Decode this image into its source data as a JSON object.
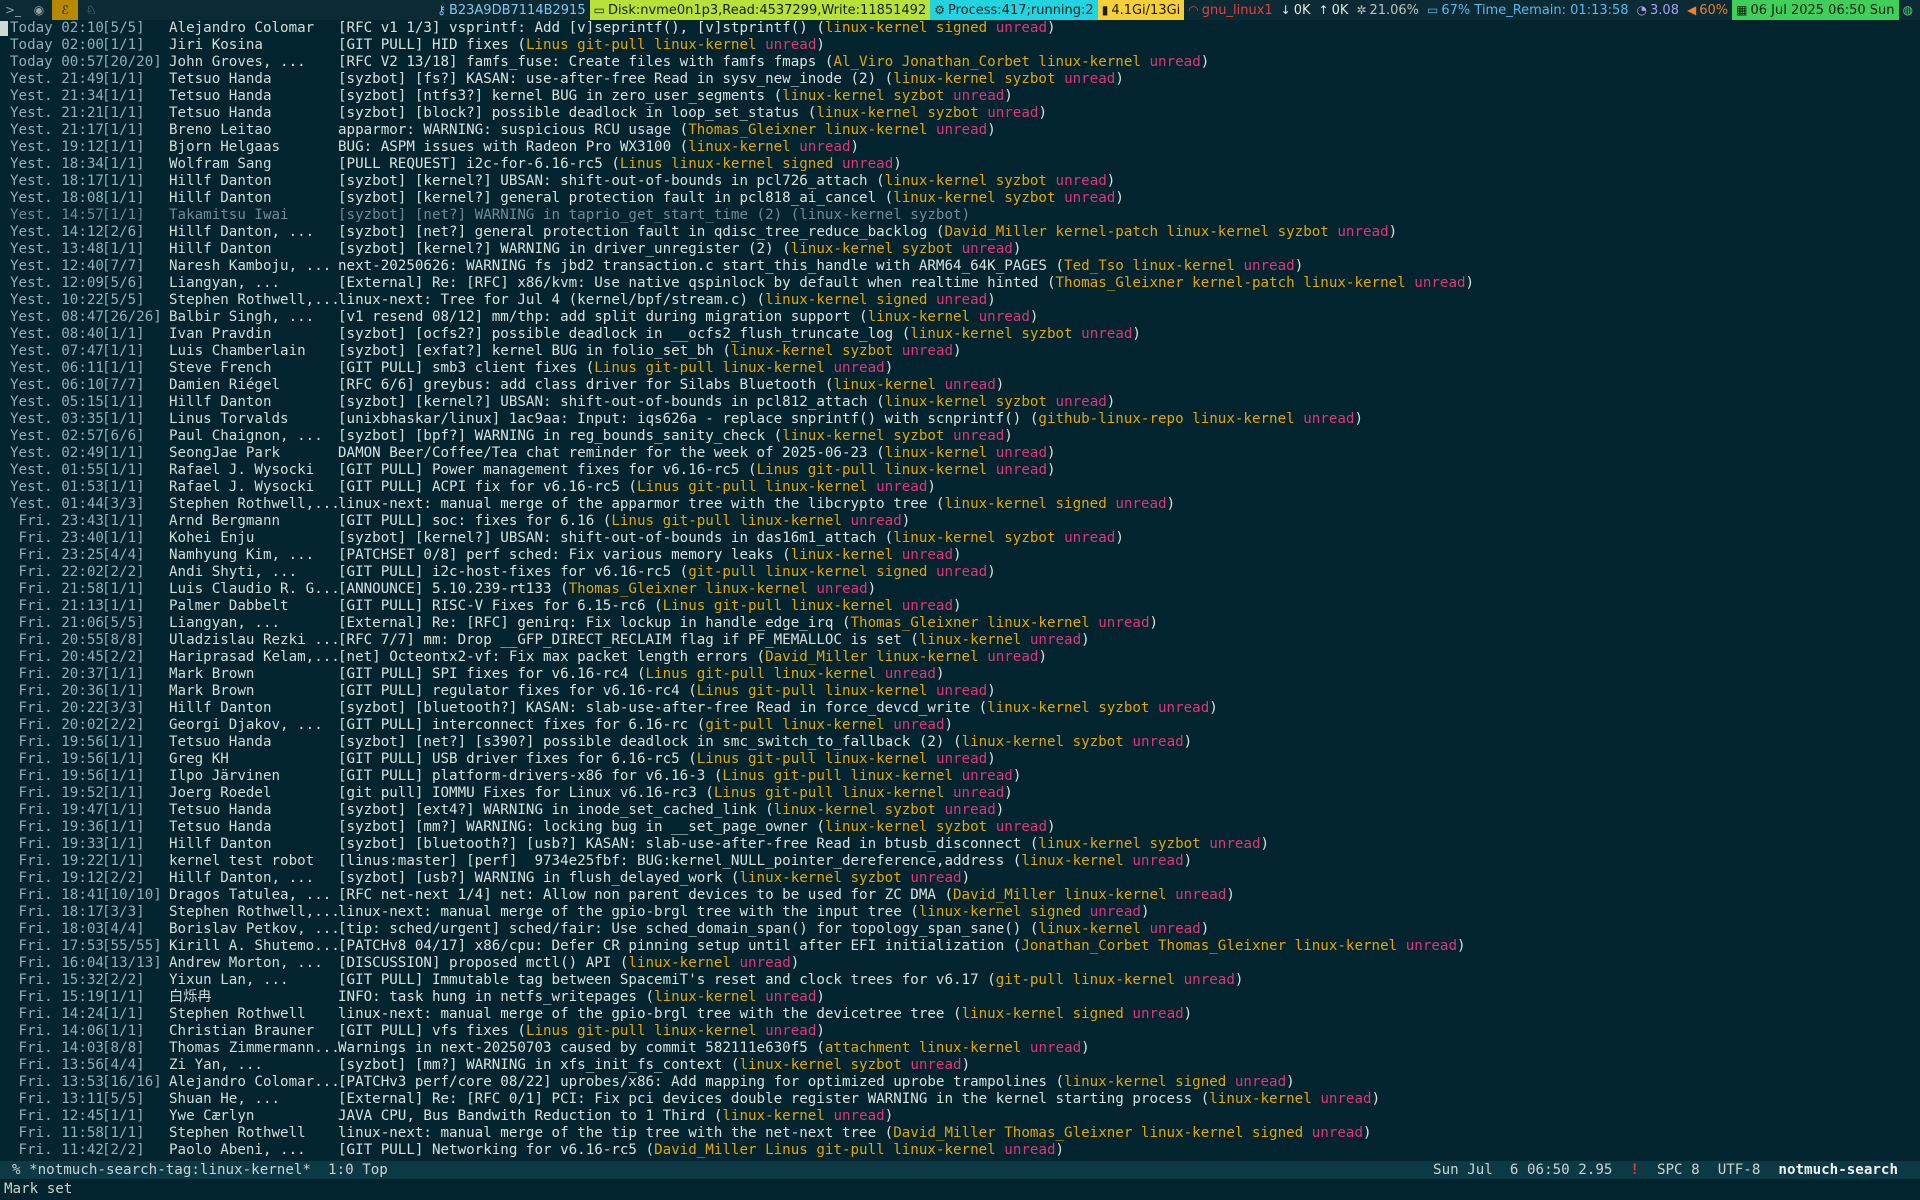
{
  "topbar": {
    "workspaces": [
      {
        "icon": "terminal-icon",
        "glyph": ">_",
        "active": false
      },
      {
        "icon": "firefox-icon",
        "glyph": "◉",
        "active": false
      },
      {
        "icon": "emacs-icon",
        "glyph": "ℰ",
        "active": true
      },
      {
        "icon": "bird-icon",
        "glyph": "♘",
        "active": false
      }
    ],
    "segments": [
      {
        "name": "key-segment",
        "icon": "key-icon",
        "glyph": "⚷",
        "text": "B23A9DB7114B2915",
        "bg": "#0a2a34",
        "fg": "#7fc8f0"
      },
      {
        "name": "disk-segment",
        "icon": "disk-icon",
        "glyph": "▭",
        "text": "Disk:nvme0n1p3,Read:4537299,Write:11851492",
        "bg": "#b8e23a",
        "fg": "#102010"
      },
      {
        "name": "process-segment",
        "icon": "process-icon",
        "glyph": "⚙",
        "text": "Process:417;running:2",
        "bg": "#22d3e0",
        "fg": "#102020"
      },
      {
        "name": "memory-segment",
        "icon": "memory-icon",
        "glyph": "▮",
        "text": "4.1Gi/13Gi",
        "bg": "#f5d03a",
        "fg": "#201800"
      },
      {
        "name": "wifi-segment",
        "icon": "wifi-icon",
        "glyph": "◠",
        "text": "gnu_linux1",
        "bg": "#0a2a34",
        "fg": "#e84040"
      },
      {
        "name": "download-segment",
        "icon": "download-icon",
        "glyph": "↓",
        "text": "0K",
        "bg": "#0a2a34",
        "fg": "#e0e8e8"
      },
      {
        "name": "upload-segment",
        "icon": "upload-icon",
        "glyph": "↑",
        "text": "0K",
        "bg": "#0a2a34",
        "fg": "#e0e8e8"
      },
      {
        "name": "cpu-segment",
        "icon": "cpu-icon",
        "glyph": "✲",
        "text": "21.06%",
        "bg": "#0a2a34",
        "fg": "#b8c4c4"
      },
      {
        "name": "battery-segment",
        "icon": "battery-icon",
        "glyph": "▭",
        "text": "67% Time_Remain: 01:13:58",
        "bg": "#0a2a34",
        "fg": "#59b8f0"
      },
      {
        "name": "load-segment",
        "icon": "gauge-icon",
        "glyph": "◔",
        "text": "3.08",
        "bg": "#0a2a34",
        "fg": "#a6a0f0"
      },
      {
        "name": "volume-segment",
        "icon": "speaker-icon",
        "glyph": "◀",
        "text": "60%",
        "bg": "#0a2a34",
        "fg": "#f07f2a"
      },
      {
        "name": "clock-segment",
        "icon": "calendar-icon",
        "glyph": "▦",
        "text": "06 Jul 2025 06:50 Sun",
        "bg": "#3fcf5a",
        "fg": "#0a200a"
      },
      {
        "name": "tray-segment",
        "icon": "tray-icon",
        "glyph": "◍",
        "text": "",
        "bg": "#0a2a34",
        "fg": "#4fd07a"
      }
    ]
  },
  "threads": [
    [
      "Today 02:10",
      "[5/5]",
      "Alejandro Colomar",
      "[RFC v1 1/3] vsprintf: Add [v]seprintf(), [v]stprintf()",
      "linux-kernel signed",
      true
    ],
    [
      "Today 02:00",
      "[1/1]",
      "Jiri Kosina",
      "[GIT PULL] HID fixes",
      "Linus git-pull linux-kernel",
      true
    ],
    [
      "Today 00:57",
      "[20/20]",
      "John Groves, ...",
      "[RFC V2 13/18] famfs_fuse: Create files with famfs fmaps",
      "Al_Viro Jonathan_Corbet linux-kernel",
      true
    ],
    [
      "Yest. 21:49",
      "[1/1]",
      "Tetsuo Handa",
      "[syzbot] [fs?] KASAN: use-after-free Read in sysv_new_inode (2)",
      "linux-kernel syzbot",
      true
    ],
    [
      "Yest. 21:34",
      "[1/1]",
      "Tetsuo Handa",
      "[syzbot] [ntfs3?] kernel BUG in zero_user_segments",
      "linux-kernel syzbot",
      true
    ],
    [
      "Yest. 21:21",
      "[1/1]",
      "Tetsuo Handa",
      "[syzbot] [block?] possible deadlock in loop_set_status",
      "linux-kernel syzbot",
      true
    ],
    [
      "Yest. 21:17",
      "[1/1]",
      "Breno Leitao",
      "apparmor: WARNING: suspicious RCU usage",
      "Thomas_Gleixner linux-kernel",
      true
    ],
    [
      "Yest. 19:12",
      "[1/1]",
      "Bjorn Helgaas",
      "BUG: ASPM issues with Radeon Pro WX3100",
      "linux-kernel",
      true
    ],
    [
      "Yest. 18:34",
      "[1/1]",
      "Wolfram Sang",
      "[PULL REQUEST] i2c-for-6.16-rc5",
      "Linus linux-kernel signed",
      true
    ],
    [
      "Yest. 18:17",
      "[1/1]",
      "Hillf Danton",
      "[syzbot] [kernel?] UBSAN: shift-out-of-bounds in pcl726_attach",
      "linux-kernel syzbot",
      true
    ],
    [
      "Yest. 18:08",
      "[1/1]",
      "Hillf Danton",
      "[syzbot] [kernel?] general protection fault in pcl818_ai_cancel",
      "linux-kernel syzbot",
      true
    ],
    [
      "Yest. 14:57",
      "[1/1]",
      "Takamitsu Iwai",
      "[syzbot] [net?] WARNING in taprio_get_start_time (2)",
      "linux-kernel syzbot",
      false
    ],
    [
      "Yest. 14:12",
      "[2/6]",
      "Hillf Danton, ...",
      "[syzbot] [net?] general protection fault in qdisc_tree_reduce_backlog",
      "David_Miller kernel-patch linux-kernel syzbot",
      true
    ],
    [
      "Yest. 13:48",
      "[1/1]",
      "Hillf Danton",
      "[syzbot] [kernel?] WARNING in driver_unregister (2)",
      "linux-kernel syzbot",
      true
    ],
    [
      "Yest. 12:40",
      "[7/7]",
      "Naresh Kamboju, ...",
      "next-20250626: WARNING fs jbd2 transaction.c start_this_handle with ARM64_64K_PAGES",
      "Ted_Tso linux-kernel",
      true
    ],
    [
      "Yest. 12:09",
      "[5/6]",
      "Liangyan, ...",
      "[External] Re: [RFC] x86/kvm: Use native qspinlock by default when realtime hinted",
      "Thomas_Gleixner kernel-patch linux-kernel",
      true
    ],
    [
      "Yest. 10:22",
      "[5/5]",
      "Stephen Rothwell,...",
      "linux-next: Tree for Jul 4 (kernel/bpf/stream.c)",
      "linux-kernel signed",
      true
    ],
    [
      "Yest. 08:47",
      "[26/26]",
      "Balbir Singh, ...",
      "[v1 resend 08/12] mm/thp: add split during migration support",
      "linux-kernel",
      true
    ],
    [
      "Yest. 08:40",
      "[1/1]",
      "Ivan Pravdin",
      "[syzbot] [ocfs2?] possible deadlock in __ocfs2_flush_truncate_log",
      "linux-kernel syzbot",
      true
    ],
    [
      "Yest. 07:47",
      "[1/1]",
      "Luis Chamberlain",
      "[syzbot] [exfat?] kernel BUG in folio_set_bh",
      "linux-kernel syzbot",
      true
    ],
    [
      "Yest. 06:11",
      "[1/1]",
      "Steve French",
      "[GIT PULL] smb3 client fixes",
      "Linus git-pull linux-kernel",
      true
    ],
    [
      "Yest. 06:10",
      "[7/7]",
      "Damien Riégel",
      "[RFC 6/6] greybus: add class driver for Silabs Bluetooth",
      "linux-kernel",
      true
    ],
    [
      "Yest. 05:15",
      "[1/1]",
      "Hillf Danton",
      "[syzbot] [kernel?] UBSAN: shift-out-of-bounds in pcl812_attach",
      "linux-kernel syzbot",
      true
    ],
    [
      "Yest. 03:35",
      "[1/1]",
      "Linus Torvalds",
      "[unixbhaskar/linux] 1ac9aa: Input: iqs626a - replace snprintf() with scnprintf()",
      "github-linux-repo linux-kernel",
      true
    ],
    [
      "Yest. 02:57",
      "[6/6]",
      "Paul Chaignon, ...",
      "[syzbot] [bpf?] WARNING in reg_bounds_sanity_check",
      "linux-kernel syzbot",
      true
    ],
    [
      "Yest. 02:49",
      "[1/1]",
      "SeongJae Park",
      "DAMON Beer/Coffee/Tea chat reminder for the week of 2025-06-23",
      "linux-kernel",
      true
    ],
    [
      "Yest. 01:55",
      "[1/1]",
      "Rafael J. Wysocki",
      "[GIT PULL] Power management fixes for v6.16-rc5",
      "Linus git-pull linux-kernel",
      true
    ],
    [
      "Yest. 01:53",
      "[1/1]",
      "Rafael J. Wysocki",
      "[GIT PULL] ACPI fix for v6.16-rc5",
      "Linus git-pull linux-kernel",
      true
    ],
    [
      "Yest. 01:44",
      "[3/3]",
      "Stephen Rothwell,...",
      "linux-next: manual merge of the apparmor tree with the libcrypto tree",
      "linux-kernel signed",
      true
    ],
    [
      " Fri. 23:43",
      "[1/1]",
      "Arnd Bergmann",
      "[GIT PULL] soc: fixes for 6.16",
      "Linus git-pull linux-kernel",
      true
    ],
    [
      " Fri. 23:40",
      "[1/1]",
      "Kohei Enju",
      "[syzbot] [kernel?] UBSAN: shift-out-of-bounds in das16m1_attach",
      "linux-kernel syzbot",
      true
    ],
    [
      " Fri. 23:25",
      "[4/4]",
      "Namhyung Kim, ...",
      "[PATCHSET 0/8] perf sched: Fix various memory leaks",
      "linux-kernel",
      true
    ],
    [
      " Fri. 22:02",
      "[2/2]",
      "Andi Shyti, ...",
      "[GIT PULL] i2c-host-fixes for v6.16-rc5",
      "git-pull linux-kernel signed",
      true
    ],
    [
      " Fri. 21:58",
      "[1/1]",
      "Luis Claudio R. G...",
      "[ANNOUNCE] 5.10.239-rt133",
      "Thomas_Gleixner linux-kernel",
      true
    ],
    [
      " Fri. 21:13",
      "[1/1]",
      "Palmer Dabbelt",
      "[GIT PULL] RISC-V Fixes for 6.15-rc6",
      "Linus git-pull linux-kernel",
      true
    ],
    [
      " Fri. 21:06",
      "[5/5]",
      "Liangyan, ...",
      "[External] Re: [RFC] genirq: Fix lockup in handle_edge_irq",
      "Thomas_Gleixner linux-kernel",
      true
    ],
    [
      " Fri. 20:55",
      "[8/8]",
      "Uladzislau Rezki ...",
      "[RFC 7/7] mm: Drop __GFP_DIRECT_RECLAIM flag if PF_MEMALLOC is set",
      "linux-kernel",
      true
    ],
    [
      " Fri. 20:45",
      "[2/2]",
      "Hariprasad Kelam,...",
      "[net] Octeontx2-vf: Fix max packet length errors",
      "David_Miller linux-kernel",
      true
    ],
    [
      " Fri. 20:37",
      "[1/1]",
      "Mark Brown",
      "[GIT PULL] SPI fixes for v6.16-rc4",
      "Linus git-pull linux-kernel",
      true
    ],
    [
      " Fri. 20:36",
      "[1/1]",
      "Mark Brown",
      "[GIT PULL] regulator fixes for v6.16-rc4",
      "Linus git-pull linux-kernel",
      true
    ],
    [
      " Fri. 20:22",
      "[3/3]",
      "Hillf Danton",
      "[syzbot] [bluetooth?] KASAN: slab-use-after-free Read in force_devcd_write",
      "linux-kernel syzbot",
      true
    ],
    [
      " Fri. 20:02",
      "[2/2]",
      "Georgi Djakov, ...",
      "[GIT PULL] interconnect fixes for 6.16-rc",
      "git-pull linux-kernel",
      true
    ],
    [
      " Fri. 19:56",
      "[1/1]",
      "Tetsuo Handa",
      "[syzbot] [net?] [s390?] possible deadlock in smc_switch_to_fallback (2)",
      "linux-kernel syzbot",
      true
    ],
    [
      " Fri. 19:56",
      "[1/1]",
      "Greg KH",
      "[GIT PULL] USB driver fixes for 6.16-rc5",
      "Linus git-pull linux-kernel",
      true
    ],
    [
      " Fri. 19:56",
      "[1/1]",
      "Ilpo Järvinen",
      "[GIT PULL] platform-drivers-x86 for v6.16-3",
      "Linus git-pull linux-kernel",
      true
    ],
    [
      " Fri. 19:52",
      "[1/1]",
      "Joerg Roedel",
      "[git pull] IOMMU Fixes for Linux v6.16-rc3",
      "Linus git-pull linux-kernel",
      true
    ],
    [
      " Fri. 19:47",
      "[1/1]",
      "Tetsuo Handa",
      "[syzbot] [ext4?] WARNING in inode_set_cached_link",
      "linux-kernel syzbot",
      true
    ],
    [
      " Fri. 19:36",
      "[1/1]",
      "Tetsuo Handa",
      "[syzbot] [mm?] WARNING: locking bug in __set_page_owner",
      "linux-kernel syzbot",
      true
    ],
    [
      " Fri. 19:33",
      "[1/1]",
      "Hillf Danton",
      "[syzbot] [bluetooth?] [usb?] KASAN: slab-use-after-free Read in btusb_disconnect",
      "linux-kernel syzbot",
      true
    ],
    [
      " Fri. 19:22",
      "[1/1]",
      "kernel test robot",
      "[linus:master] [perf]  9734e25fbf: BUG:kernel_NULL_pointer_dereference,address",
      "linux-kernel",
      true
    ],
    [
      " Fri. 19:12",
      "[2/2]",
      "Hillf Danton, ...",
      "[syzbot] [usb?] WARNING in flush_delayed_work",
      "linux-kernel syzbot",
      true
    ],
    [
      " Fri. 18:41",
      "[10/10]",
      "Dragos Tatulea, ...",
      "[RFC net-next 1/4] net: Allow non parent devices to be used for ZC DMA",
      "David_Miller linux-kernel",
      true
    ],
    [
      " Fri. 18:17",
      "[3/3]",
      "Stephen Rothwell,...",
      "linux-next: manual merge of the gpio-brgl tree with the input tree",
      "linux-kernel signed",
      true
    ],
    [
      " Fri. 18:03",
      "[4/4]",
      "Borislav Petkov, ...",
      "[tip: sched/urgent] sched/fair: Use sched_domain_span() for topology_span_sane()",
      "linux-kernel",
      true
    ],
    [
      " Fri. 17:53",
      "[55/55]",
      "Kirill A. Shutemo...",
      "[PATCHv8 04/17] x86/cpu: Defer CR pinning setup until after EFI initialization",
      "Jonathan_Corbet Thomas_Gleixner linux-kernel",
      true
    ],
    [
      " Fri. 16:04",
      "[13/13]",
      "Andrew Morton, ...",
      "[DISCUSSION] proposed mctl() API",
      "linux-kernel",
      true
    ],
    [
      " Fri. 15:32",
      "[2/2]",
      "Yixun Lan, ...",
      "[GIT PULL] Immutable tag between SpacemiT's reset and clock trees for v6.17",
      "git-pull linux-kernel",
      true
    ],
    [
      " Fri. 15:19",
      "[1/1]",
      "白烁冉",
      "INFO: task hung in netfs_writepages",
      "linux-kernel",
      true
    ],
    [
      " Fri. 14:24",
      "[1/1]",
      "Stephen Rothwell",
      "linux-next: manual merge of the gpio-brgl tree with the devicetree tree",
      "linux-kernel signed",
      true
    ],
    [
      " Fri. 14:06",
      "[1/1]",
      "Christian Brauner",
      "[GIT PULL] vfs fixes",
      "Linus git-pull linux-kernel",
      true
    ],
    [
      " Fri. 14:03",
      "[8/8]",
      "Thomas Zimmermann...",
      "Warnings in next-20250703 caused by commit 582111e630f5",
      "attachment linux-kernel",
      true
    ],
    [
      " Fri. 13:56",
      "[4/4]",
      "Zi Yan, ...",
      "[syzbot] [mm?] WARNING in xfs_init_fs_context",
      "linux-kernel syzbot",
      true
    ],
    [
      " Fri. 13:53",
      "[16/16]",
      "Alejandro Colomar...",
      "[PATCHv3 perf/core 08/22] uprobes/x86: Add mapping for optimized uprobe trampolines",
      "linux-kernel signed",
      true
    ],
    [
      " Fri. 13:11",
      "[5/5]",
      "Shuan He, ...",
      "[External] Re: [RFC 0/1] PCI: Fix pci devices double register WARNING in the kernel starting process",
      "linux-kernel",
      true
    ],
    [
      " Fri. 12:45",
      "[1/1]",
      "Ywe Cærlyn",
      "JAVA CPU, Bus Bandwith Reduction to 1 Third",
      "linux-kernel",
      true
    ],
    [
      " Fri. 11:58",
      "[1/1]",
      "Stephen Rothwell",
      "linux-next: manual merge of the tip tree with the net-next tree",
      "David_Miller Thomas_Gleixner linux-kernel signed",
      true
    ],
    [
      " Fri. 11:42",
      "[2/2]",
      "Paolo Abeni, ...",
      "[GIT PULL] Networking for v6.16-rc5",
      "David_Miller Linus git-pull linux-kernel",
      true
    ]
  ],
  "unread_label": "unread",
  "modeline": {
    "left": "% *notmuch-search-tag:linux-kernel*  1:0 Top",
    "time": "Sun Jul  6 06:50 2.95",
    "bang": "!",
    "spc": "SPC 8",
    "encoding": "UTF-8",
    "mode": "notmuch-search"
  },
  "echo": "Mark set"
}
